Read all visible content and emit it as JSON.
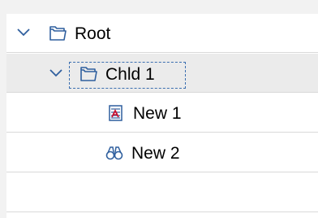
{
  "tree": {
    "nodes": [
      {
        "label": "Root",
        "icon": "folder-icon",
        "expanded": true,
        "level": 0
      },
      {
        "label": "Chld 1",
        "icon": "folder-icon",
        "expanded": true,
        "level": 1,
        "focused": true
      },
      {
        "label": "New 1",
        "icon": "document-chart-icon",
        "level": 2
      },
      {
        "label": "New 2",
        "icon": "binoculars-icon",
        "level": 2
      }
    ]
  },
  "colors": {
    "icon_stroke": "#2f5f9e",
    "selection_row": "#ebebeb",
    "focus_border": "#3b6fb0",
    "accent_red": "#c8102e"
  }
}
